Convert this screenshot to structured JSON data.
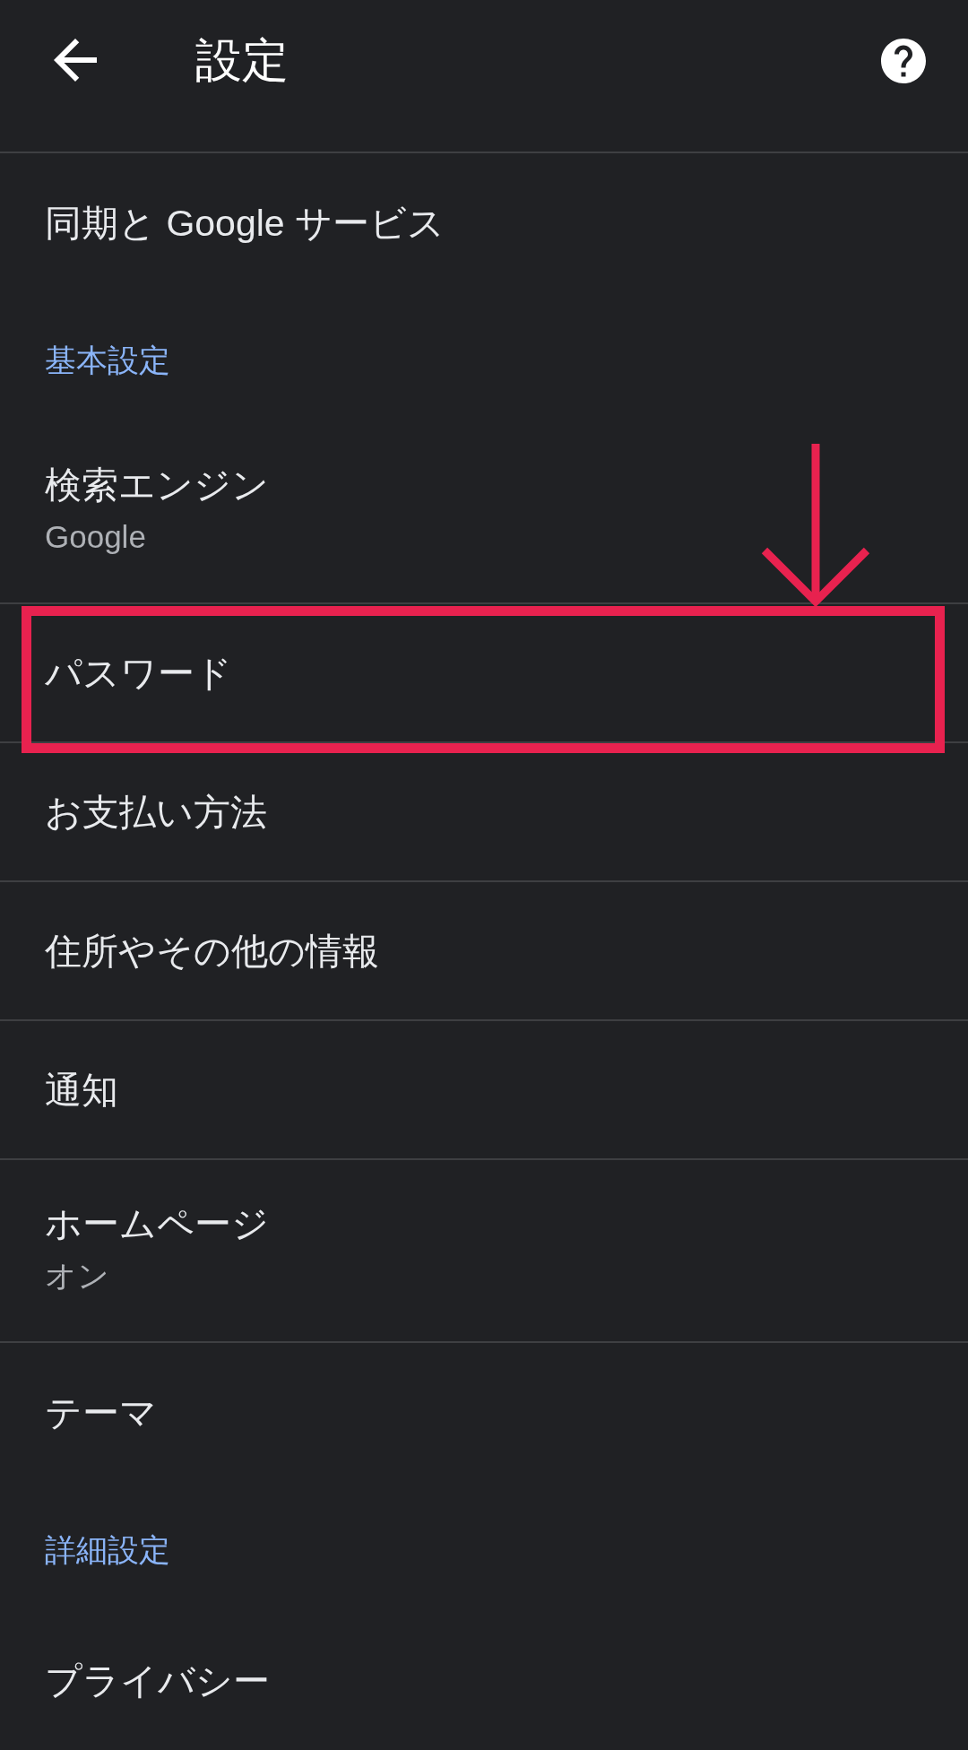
{
  "app_bar": {
    "title": "設定"
  },
  "sections": [
    {
      "items": [
        {
          "title": "同期と Google サービス",
          "highlighted": false
        }
      ]
    },
    {
      "header": "基本設定",
      "items": [
        {
          "title": "検索エンジン",
          "summary": "Google",
          "highlighted": false
        },
        {
          "title": "パスワード",
          "highlighted": true
        },
        {
          "title": "お支払い方法",
          "highlighted": false
        },
        {
          "title": "住所やその他の情報",
          "highlighted": false
        },
        {
          "title": "通知",
          "highlighted": false
        },
        {
          "title": "ホームページ",
          "summary": "オン",
          "highlighted": false
        },
        {
          "title": "テーマ",
          "highlighted": false
        }
      ]
    },
    {
      "header": "詳細設定",
      "items": [
        {
          "title": "プライバシー",
          "highlighted": false
        }
      ]
    }
  ]
}
